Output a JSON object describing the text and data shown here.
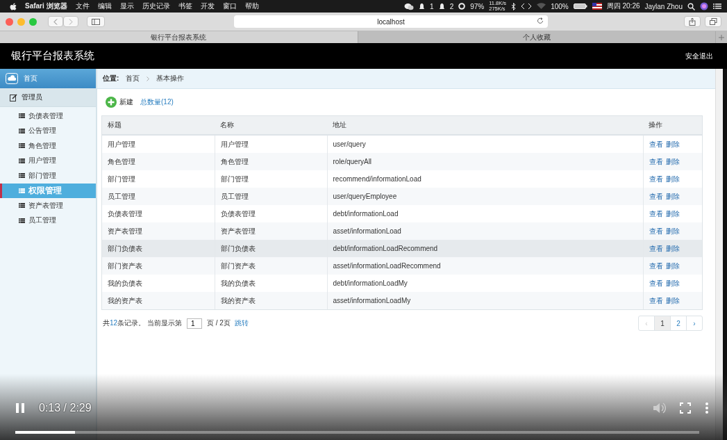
{
  "menubar": {
    "app": "Safari 浏览器",
    "menus": [
      "文件",
      "编辑",
      "显示",
      "历史记录",
      "书签",
      "开发",
      "窗口",
      "帮助"
    ],
    "status": {
      "notif1": "1",
      "notif2": "2",
      "cpu": "97%",
      "net_up": "11.8K/s",
      "net_down": "275K/s",
      "battery": "100%",
      "clock": "周四 20:26",
      "user": "Jaylan Zhou"
    }
  },
  "browser": {
    "address": "localhost",
    "tabs": [
      {
        "label": "银行平台报表系统",
        "selected": true
      },
      {
        "label": "个人收藏",
        "selected": false
      }
    ]
  },
  "app": {
    "title": "银行平台报表系统",
    "logout": "安全退出"
  },
  "sidebar": {
    "home": "首页",
    "group": "管理员",
    "items": [
      {
        "label": "负债表管理",
        "selected": false
      },
      {
        "label": "公告管理",
        "selected": false
      },
      {
        "label": "角色管理",
        "selected": false
      },
      {
        "label": "用户管理",
        "selected": false
      },
      {
        "label": "部门管理",
        "selected": false
      },
      {
        "label": "权限管理",
        "selected": true
      },
      {
        "label": "资产表管理",
        "selected": false
      },
      {
        "label": "员工管理",
        "selected": false
      }
    ]
  },
  "breadcrumb": {
    "label": "位置:",
    "items": [
      "首页",
      "基本操作"
    ]
  },
  "toolbar": {
    "new": "新建",
    "count": "总数量(12)"
  },
  "table": {
    "columns": [
      "标题",
      "名称",
      "地址",
      "操作"
    ],
    "rows": [
      {
        "cells": [
          "用户管理",
          "用户管理",
          "user/query"
        ],
        "actions": [
          "查看",
          "删除"
        ],
        "hovered": false
      },
      {
        "cells": [
          "角色管理",
          "角色管理",
          "role/queryAll"
        ],
        "actions": [
          "查看",
          "删除"
        ],
        "hovered": false
      },
      {
        "cells": [
          "部门管理",
          "部门管理",
          "recommend/informationLoad"
        ],
        "actions": [
          "查看",
          "删除"
        ],
        "hovered": false
      },
      {
        "cells": [
          "员工管理",
          "员工管理",
          "user/queryEmployee"
        ],
        "actions": [
          "查看",
          "删除"
        ],
        "hovered": false
      },
      {
        "cells": [
          "负债表管理",
          "负债表管理",
          "debt/informationLoad"
        ],
        "actions": [
          "查看",
          "删除"
        ],
        "hovered": false
      },
      {
        "cells": [
          "资产表管理",
          "资产表管理",
          "asset/informationLoad"
        ],
        "actions": [
          "查看",
          "删除"
        ],
        "hovered": false
      },
      {
        "cells": [
          "部门负债表",
          "部门负债表",
          "debt/informationLoadRecommend"
        ],
        "actions": [
          "查看",
          "删除"
        ],
        "hovered": true
      },
      {
        "cells": [
          "部门资产表",
          "部门资产表",
          "asset/informationLoadRecommend"
        ],
        "actions": [
          "查看",
          "删除"
        ],
        "hovered": false
      },
      {
        "cells": [
          "我的负债表",
          "我的负债表",
          "debt/informationLoadMy"
        ],
        "actions": [
          "查看",
          "删除"
        ],
        "hovered": false
      },
      {
        "cells": [
          "我的资产表",
          "我的资产表",
          "asset/informationLoadMy"
        ],
        "actions": [
          "查看",
          "删除"
        ],
        "hovered": false
      }
    ]
  },
  "pagination": {
    "prefix": "共",
    "total": "12",
    "middle": "条记录。 当前显示第",
    "page_input": "1",
    "suffix": "页 / 2页",
    "jump": "跳转",
    "pages": [
      {
        "label": "‹",
        "selected": false,
        "disabled": true
      },
      {
        "label": "1",
        "selected": true,
        "disabled": false
      },
      {
        "label": "2",
        "selected": false,
        "disabled": false
      },
      {
        "label": "›",
        "selected": false,
        "disabled": false
      }
    ]
  },
  "video": {
    "time": "0:13 / 2:29",
    "progress": {
      "level": 0.087
    }
  }
}
